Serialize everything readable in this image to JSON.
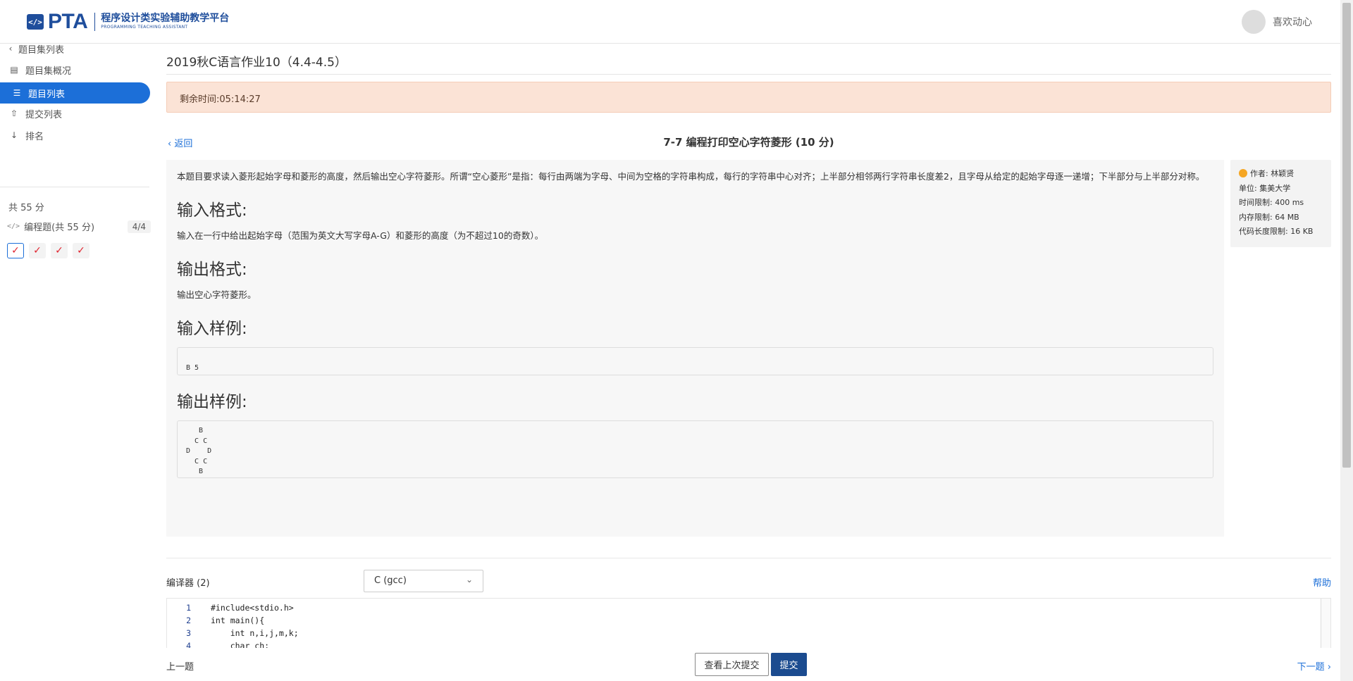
{
  "header": {
    "logo_mark": "</>",
    "logo_text": "PTA",
    "logo_cn": "程序设计类实验辅助教学平台",
    "logo_en": "PROGRAMMING TEACHING ASSISTANT",
    "user_name": "喜欢动心"
  },
  "sidebar": {
    "back_label": "题目集列表",
    "items": [
      {
        "label": "题目集概况",
        "icon": "book-icon"
      },
      {
        "label": "题目列表",
        "icon": "list-icon"
      },
      {
        "label": "提交列表",
        "icon": "upload-icon"
      },
      {
        "label": "排名",
        "icon": "sort-icon"
      }
    ],
    "total": "共 55 分",
    "category": {
      "label": "编程题(共 55 分)",
      "count": "4/4"
    },
    "checks": [
      "✓",
      "✓",
      "✓",
      "✓"
    ]
  },
  "main": {
    "set_title": "2019秋C语言作业10（4.4-4.5）",
    "timer": "剩余时间:05:14:27",
    "back_label": "返回",
    "problem_title": "7-7 编程打印空心字符菱形 (10 分)",
    "description": "本题目要求读入菱形起始字母和菱形的高度，然后输出空心字符菱形。所谓“空心菱形”是指：每行由两端为字母、中间为空格的字符串构成，每行的字符串中心对齐；上半部分相邻两行字符串长度差2，且字母从给定的起始字母逐一递增；下半部分与上半部分对称。",
    "input_format_heading": "输入格式:",
    "input_format": "输入在一行中给出起始字母（范围为英文大写字母A-G）和菱形的高度（为不超过10的奇数）。",
    "output_format_heading": "输出格式:",
    "output_format": "输出空心字符菱形。",
    "sample_input_heading": "输入样例:",
    "sample_input": "\nB 5",
    "sample_output_heading": "输出样例:",
    "sample_output": "   B\n  C C\nD    D\n  C C\n   B",
    "meta": {
      "author": "作者: 林颖贤",
      "unit": "单位: 集美大学",
      "time_limit": "时间限制: 400 ms",
      "memory_limit": "内存限制: 64 MB",
      "code_limit": "代码长度限制: 16 KB"
    },
    "compiler_label": "编译器 (2)",
    "compiler_selected": "C (gcc)",
    "help_label": "帮助",
    "code_lines": [
      {
        "no": "1",
        "text": "#include<stdio.h>"
      },
      {
        "no": "2",
        "text": "int main(){"
      },
      {
        "no": "3",
        "text": "    int n,i,j,m,k;"
      },
      {
        "no": "4",
        "text": "    char ch;"
      }
    ]
  },
  "footer": {
    "prev_label": "上一题",
    "last_submission_label": "查看上次提交",
    "submit_label": "提交",
    "next_label": "下一题"
  }
}
